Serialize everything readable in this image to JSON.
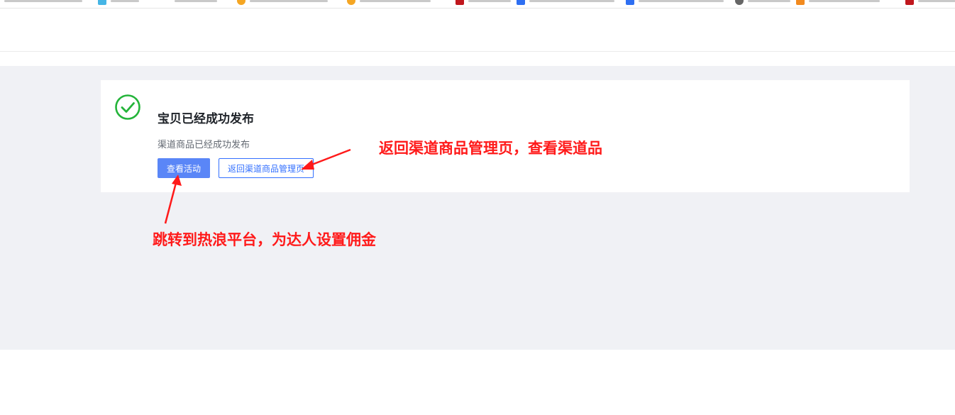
{
  "result": {
    "title": "宝贝已经成功发布",
    "description": "渠道商品已经成功发布",
    "success_color": "#24b43a"
  },
  "actions": {
    "view_activity_label": "查看活动",
    "return_label": "返回渠道商品管理页"
  },
  "annotations": {
    "return_note": "返回渠道商品管理页，查看渠道品",
    "view_note": "跳转到热浪平台，为达人设置佣金",
    "color": "#ff1a1a"
  },
  "colors": {
    "primary": "#5a86f7",
    "link": "#3370ff",
    "page_bg": "#f0f1f5"
  }
}
